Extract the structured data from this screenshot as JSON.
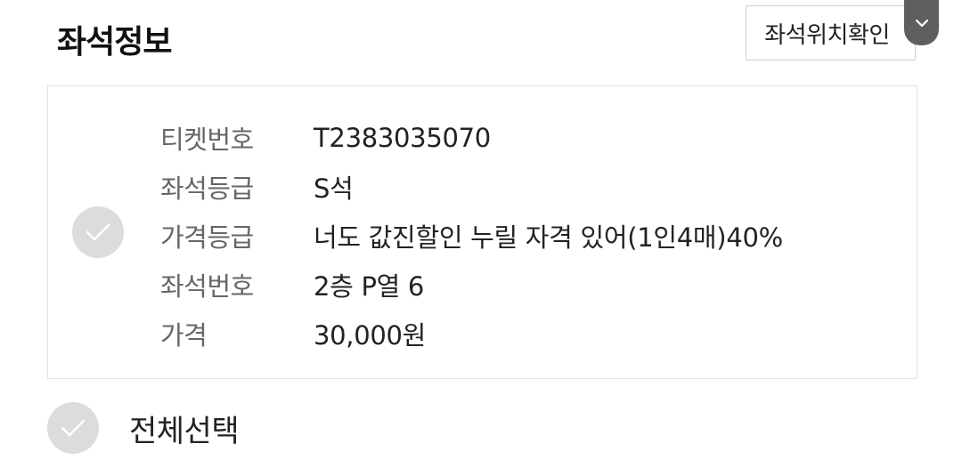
{
  "header": {
    "title": "좌석정보",
    "seat_location_button": "좌석위치확인",
    "toggle_icon": "chevron-down-icon"
  },
  "seat_card": {
    "check_icon": "check-icon",
    "rows": [
      {
        "label": "티켓번호",
        "value": "T2383035070"
      },
      {
        "label": "좌석등급",
        "value": "S석"
      },
      {
        "label": "가격등급",
        "value": "너도 값진할인 누릴 자격 있어(1인4매)40%"
      },
      {
        "label": "좌석번호",
        "value": "2층 P열 6"
      },
      {
        "label": "가격",
        "value": "30,000원"
      }
    ]
  },
  "select_all": {
    "label": "전체선택",
    "check_icon": "check-icon"
  },
  "colors": {
    "check_circle": "#dcdcdc",
    "toggle_bg": "#5f5f5f",
    "label_text": "#666666",
    "value_text": "#222222"
  }
}
